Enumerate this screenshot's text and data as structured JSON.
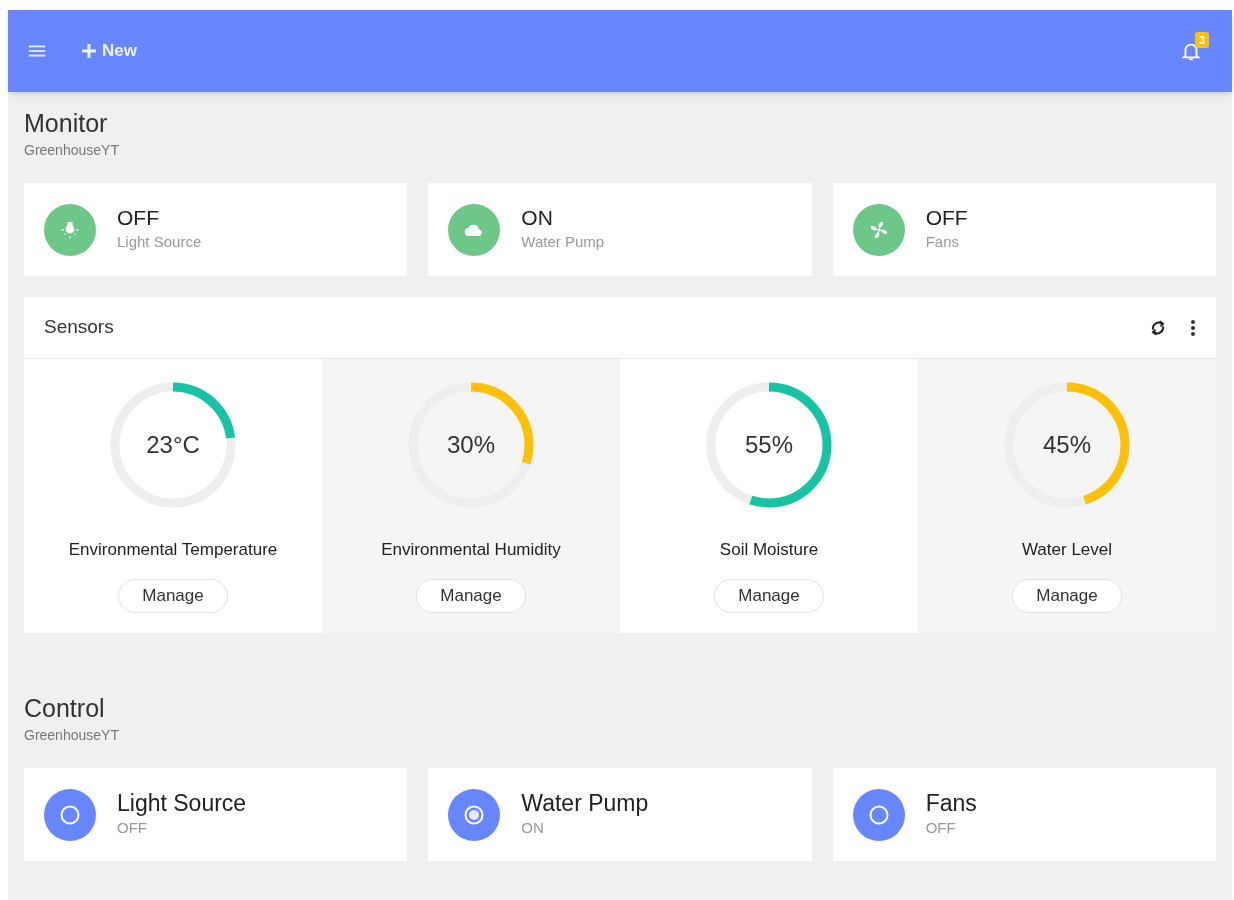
{
  "topbar": {
    "new_label": "New",
    "notifications": "3"
  },
  "monitor": {
    "title": "Monitor",
    "subtitle": "GreenhouseYT",
    "items": [
      {
        "kind": "light",
        "status": "OFF",
        "label": "Light Source"
      },
      {
        "kind": "cloud",
        "status": "ON",
        "label": "Water Pump"
      },
      {
        "kind": "fan",
        "status": "OFF",
        "label": "Fans"
      }
    ]
  },
  "sensors": {
    "title": "Sensors",
    "items": [
      {
        "reading": "23°C",
        "label": "Environmental Temperature",
        "color": "#17c3a5",
        "button": "Manage"
      },
      {
        "reading": "30%",
        "label": "Environmental Humidity",
        "color": "#ffc107",
        "button": "Manage"
      },
      {
        "reading": "55%",
        "label": "Soil Moisture",
        "color": "#17c3a5",
        "button": "Manage"
      },
      {
        "reading": "45%",
        "label": "Water Level",
        "color": "#ffc107",
        "button": "Manage"
      }
    ]
  },
  "control": {
    "title": "Control",
    "subtitle": "GreenhouseYT",
    "items": [
      {
        "label": "Light Source",
        "status": "OFF",
        "on": false
      },
      {
        "label": "Water Pump",
        "status": "ON",
        "on": true
      },
      {
        "label": "Fans",
        "status": "OFF",
        "on": false
      }
    ]
  }
}
